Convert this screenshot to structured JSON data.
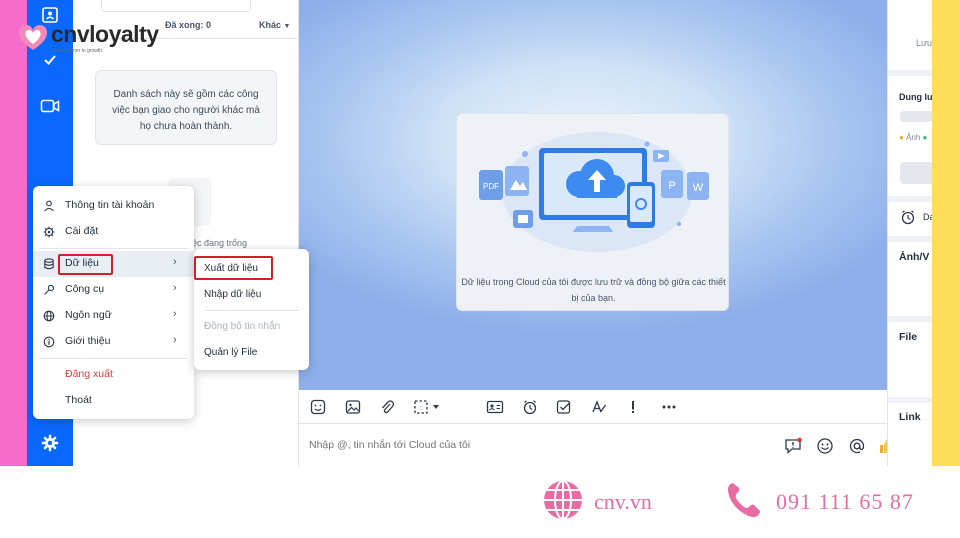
{
  "brand": {
    "logo": "cnvloyalty",
    "tagline": "Your partner in growth"
  },
  "todo": {
    "done_label": "Đã xong: 0",
    "other_label": "Khác",
    "empty_message": "Danh sách này sẽ gồm các công việc bạn giao cho người khác mà họ chưa hoàn thành.",
    "partial_text": "ệc đang trống"
  },
  "cloud": {
    "caption": "Dữ liệu trong Cloud của tôi được lưu trữ và đồng bộ giữa các thiết bị của bạn."
  },
  "file_types": [
    "PDF",
    "P",
    "W"
  ],
  "menu": {
    "items": [
      {
        "label": "Thông tin tài khoản",
        "icon": "user-icon"
      },
      {
        "label": "Cài đặt",
        "icon": "gear-icon"
      },
      {
        "label": "Dữ liệu",
        "icon": "database-icon",
        "has_submenu": true
      },
      {
        "label": "Công cụ",
        "icon": "wrench-icon",
        "has_submenu": true
      },
      {
        "label": "Ngôn ngữ",
        "icon": "globe-icon",
        "has_submenu": true
      },
      {
        "label": "Giới thiệu",
        "icon": "info-icon",
        "has_submenu": true
      }
    ],
    "logout": "Đăng xuất",
    "exit": "Thoát",
    "chevron": "›"
  },
  "submenu": {
    "items": [
      "Xuất dữ liệu",
      "Nhập dữ liệu",
      "Đồng bộ tin nhắn",
      "Quản lý File"
    ]
  },
  "composer": {
    "placeholder": "Nhập @, tin nhắn tới Cloud của tôi"
  },
  "info_panel": {
    "storage_top": "Lưu",
    "storage_title": "Dung lư",
    "legend_image": "Ảnh",
    "reminder": "Da",
    "media_title": "Ảnh/V",
    "file_title": "File",
    "link_title": "Link"
  },
  "footer": {
    "website": "cnv.vn",
    "phone": "091 111 65 87"
  },
  "colors": {
    "nav_blue": "#0a68ff",
    "pink_stripe": "#f56ccb",
    "yellow_stripe": "#fedd58",
    "highlight_red": "#d0202a",
    "logout_red": "#e23a3a",
    "footer_pink": "#e96ba4"
  }
}
